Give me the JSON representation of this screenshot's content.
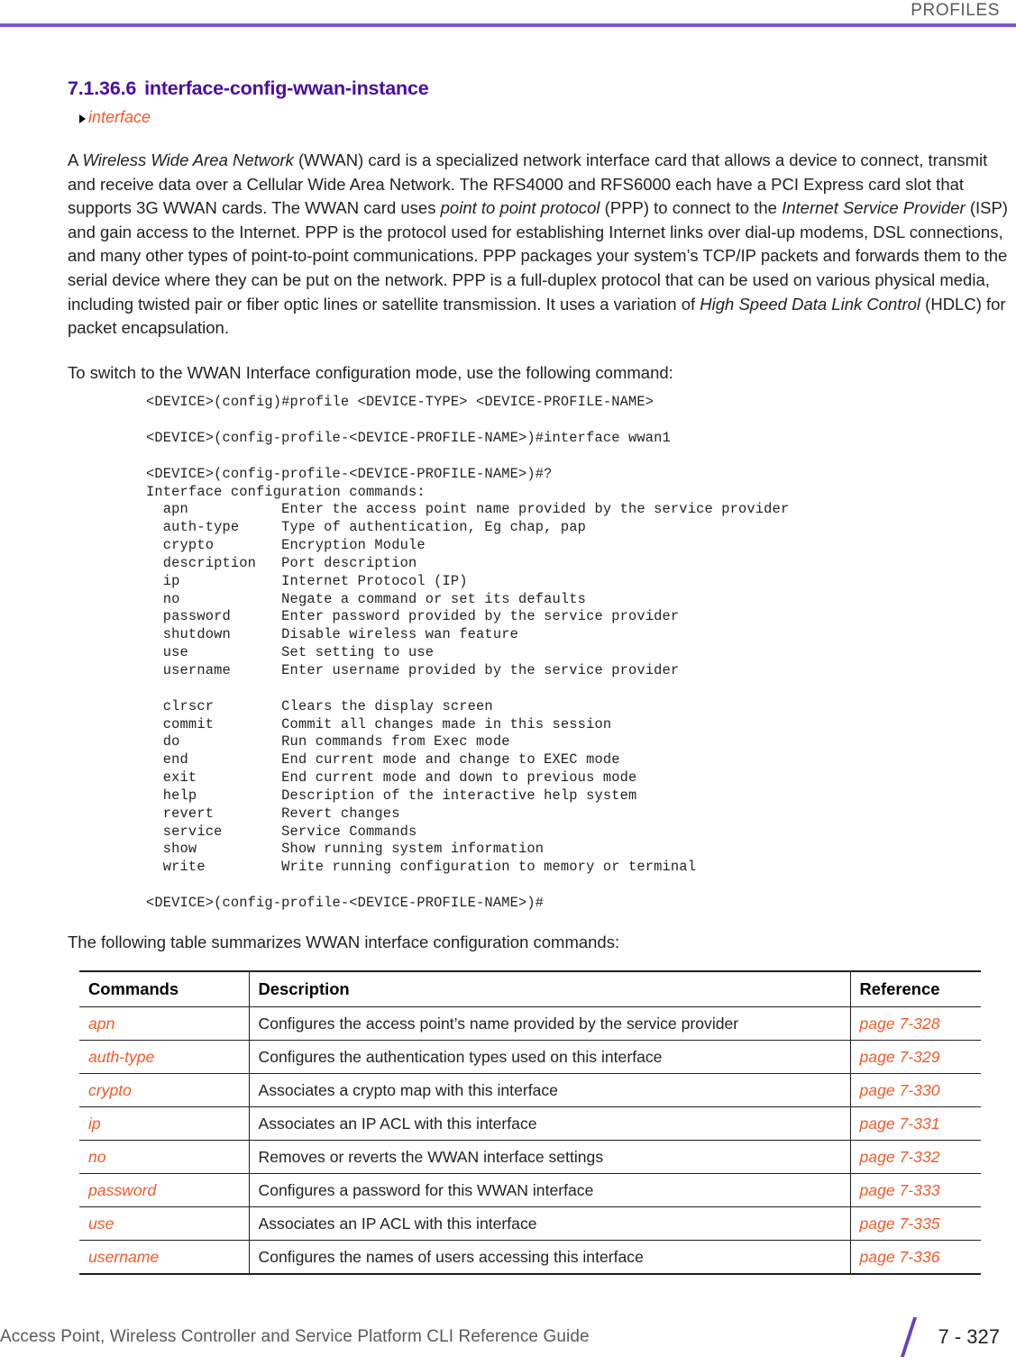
{
  "header": {
    "title": "PROFILES",
    "rule_color": "#7d55c7"
  },
  "heading": {
    "number": "7.1.36.6",
    "title": "interface-config-wwan-instance",
    "color": "#4b0d9e"
  },
  "breadcrumb": {
    "label": "interface",
    "color": "#f15a29"
  },
  "paragraphs": {
    "intro": {
      "p1": "A ",
      "em1": "Wireless Wide Area Network",
      "p2": " (WWAN) card is a specialized network interface card that allows a device to connect, transmit and receive data over a Cellular Wide Area Network. The RFS4000 and RFS6000 each have a PCI Express card slot that supports 3G WWAN cards. The WWAN card uses ",
      "em2": "point to point protocol",
      "p3": " (PPP) to connect to the ",
      "em3": "Internet Service Provider",
      "p4": " (ISP) and gain access to the Internet. PPP is the protocol used for establishing Internet links over dial-up modems, DSL connections, and many other types of point-to-point communications. PPP packages your system’s TCP/IP packets and forwards them to the serial device where they can be put on the network. PPP is a full-duplex protocol that can be used on various physical media, including twisted pair or fiber optic lines or satellite transmission. It uses a variation of ",
      "em4": "High Speed Data Link Control",
      "p5": " (HDLC) for packet encapsulation."
    },
    "switch_mode": "To switch to the WWAN Interface configuration mode, use the following command:",
    "table_intro": "The following table summarizes WWAN interface configuration commands:"
  },
  "cli_block": "<DEVICE>(config)#profile <DEVICE-TYPE> <DEVICE-PROFILE-NAME>\n\n<DEVICE>(config-profile-<DEVICE-PROFILE-NAME>)#interface wwan1\n\n<DEVICE>(config-profile-<DEVICE-PROFILE-NAME>)#?\nInterface configuration commands:\n  apn           Enter the access point name provided by the service provider\n  auth-type     Type of authentication, Eg chap, pap\n  crypto        Encryption Module\n  description   Port description\n  ip            Internet Protocol (IP)\n  no            Negate a command or set its defaults\n  password      Enter password provided by the service provider\n  shutdown      Disable wireless wan feature\n  use           Set setting to use\n  username      Enter username provided by the service provider\n\n  clrscr        Clears the display screen\n  commit        Commit all changes made in this session\n  do            Run commands from Exec mode\n  end           End current mode and change to EXEC mode\n  exit          End current mode and down to previous mode\n  help          Description of the interactive help system\n  revert        Revert changes\n  service       Service Commands\n  show          Show running system information\n  write         Write running configuration to memory or terminal\n\n<DEVICE>(config-profile-<DEVICE-PROFILE-NAME>)#",
  "table": {
    "headers": [
      "Commands",
      "Description",
      "Reference"
    ],
    "rows": [
      {
        "command": "apn",
        "description": "Configures the access point’s name provided by the service provider",
        "reference": "page 7-328"
      },
      {
        "command": "auth-type",
        "description": "Configures the authentication types used on this interface",
        "reference": "page 7-329"
      },
      {
        "command": "crypto",
        "description": "Associates a crypto map with this interface",
        "reference": "page 7-330"
      },
      {
        "command": "ip",
        "description": "Associates an IP ACL with this interface",
        "reference": "page 7-331"
      },
      {
        "command": "no",
        "description": "Removes or reverts the WWAN interface settings",
        "reference": "page 7-332"
      },
      {
        "command": "password",
        "description": "Configures a password for this WWAN interface",
        "reference": "page 7-333"
      },
      {
        "command": "use",
        "description": "Associates an IP ACL with this interface",
        "reference": "page 7-335"
      },
      {
        "command": "username",
        "description": "Configures the names of users accessing this interface",
        "reference": "page 7-336"
      }
    ]
  },
  "footer": {
    "title": "Access Point, Wireless Controller and Service Platform CLI Reference Guide",
    "page_number": "7 - 327",
    "slash_color": "#6b3fc0"
  }
}
